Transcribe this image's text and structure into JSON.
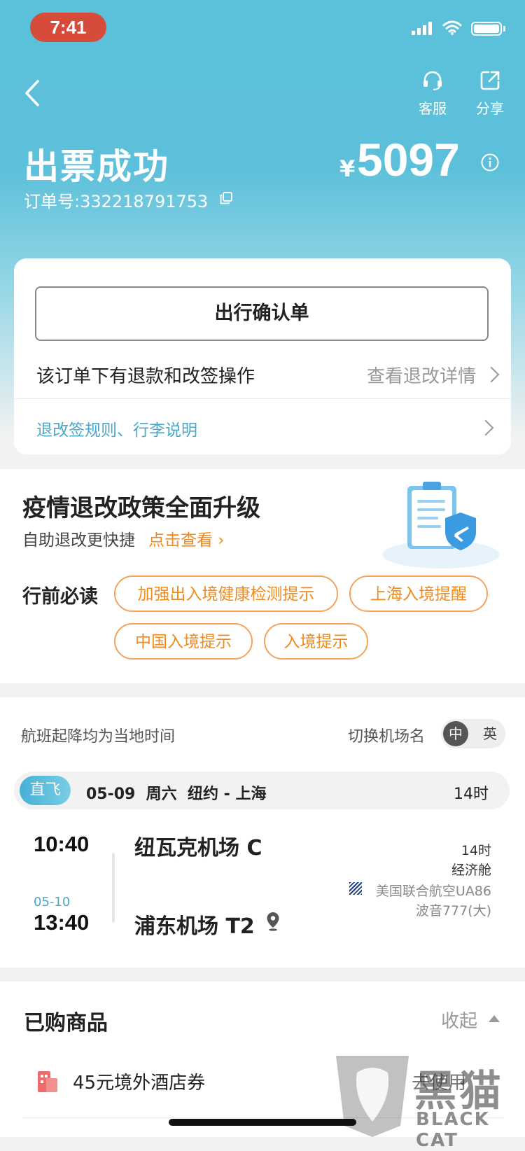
{
  "status_bar": {
    "time": "7:41"
  },
  "header": {
    "service_label": "客服",
    "share_label": "分享",
    "title": "出票成功",
    "order_number": "订单号:332218791753",
    "currency": "¥",
    "price": "5097"
  },
  "order_card": {
    "confirm_button": "出行确认单",
    "refund_note": "该订单下有退款和改签操作",
    "refund_link": "查看退改详情",
    "rules_link": "退改签规则、行李说明"
  },
  "policy": {
    "title": "疫情退改政策全面升级",
    "subtitle": "自助退改更快捷",
    "link": "点击查看",
    "must_read_label": "行前必读",
    "tags": [
      "加强出入境健康检测提示",
      "上海入境提醒",
      "中国入境提示",
      "入境提示"
    ]
  },
  "flight": {
    "local_time_note": "航班起降均为当地时间",
    "switch_label": "切换机场名",
    "lang_zh": "中",
    "lang_en": "英",
    "direct_label": "直飞",
    "route": "05-09  周六  纽约 - 上海",
    "route_duration": "14时",
    "departure_time": "10:40",
    "departure_airport": "纽瓦克机场 C",
    "arrival_date": "05-10",
    "arrival_time": "13:40",
    "arrival_airport": "浦东机场 T2",
    "duration": "14时",
    "cabin": "经济舱",
    "airline": "美国联合航空UA86",
    "aircraft": "波音777(大)"
  },
  "purchased": {
    "title": "已购商品",
    "collapse_label": "收起",
    "items": [
      {
        "name": "45元境外酒店券",
        "action": "去使用"
      }
    ]
  },
  "watermark": {
    "cn": "黑猫",
    "en": "BLACK CAT"
  },
  "colors": {
    "header": "#5bc1db",
    "accent_orange": "#f08a1c",
    "link_blue": "#4aa8c8",
    "status_red": "#d74b3a"
  }
}
